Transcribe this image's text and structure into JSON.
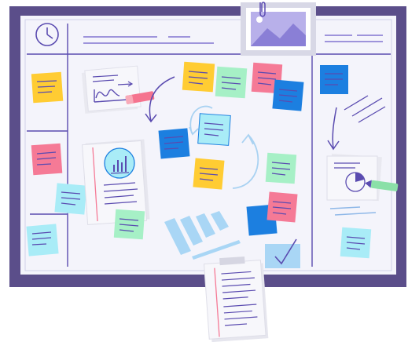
{
  "board": {
    "frame_color": "#5b4e8a",
    "surface_color": "#f4f4fb",
    "line_color": "#5a4bb0"
  },
  "palette": {
    "yellow": "#ffcc33",
    "pink": "#f57a96",
    "blue": "#1c7fe0",
    "cyan": "#a9ecf7",
    "mint": "#a6f0c6",
    "paper": "#f1f1f1",
    "pencil": "#8be0a8",
    "eraser": "#f5748f"
  },
  "icons": {
    "clock": "clock-icon",
    "photo": "image-icon",
    "bar_chart": "bar-chart-icon",
    "pie_chart": "pie-chart-icon",
    "line_chart": "line-chart-icon",
    "check": "checkmark-icon",
    "paperclip": "paperclip-icon"
  }
}
